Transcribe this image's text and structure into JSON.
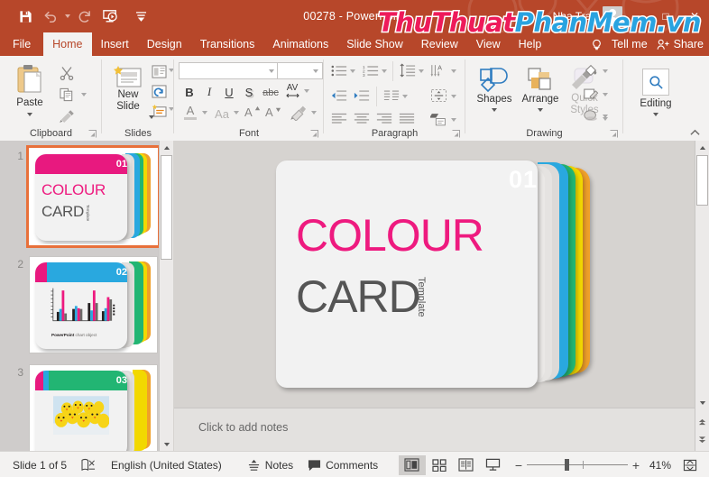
{
  "titlebar": {
    "document_title": "00278  -  PowerPoint",
    "account_name": "Nha Tran",
    "qat": [
      {
        "name": "save",
        "label": "Save"
      },
      {
        "name": "undo",
        "label": "Undo"
      },
      {
        "name": "redo",
        "label": "Redo"
      },
      {
        "name": "start-presentation",
        "label": "Start From Beginning"
      },
      {
        "name": "customize-qat",
        "label": "Customize Quick Access Toolbar"
      }
    ],
    "window_buttons": [
      "–",
      "□",
      "✕"
    ],
    "restore_ribbon_icon": "❐"
  },
  "watermark": {
    "part1": "ThuThuat",
    "part2": "PhanMem",
    "part3": ".vn",
    "color1": "#ee1a5a",
    "color2": "#29a3e0"
  },
  "tabs": [
    {
      "label": "File",
      "active": false
    },
    {
      "label": "Home",
      "active": true
    },
    {
      "label": "Insert",
      "active": false
    },
    {
      "label": "Design",
      "active": false
    },
    {
      "label": "Transitions",
      "active": false
    },
    {
      "label": "Animations",
      "active": false
    },
    {
      "label": "Slide Show",
      "active": false
    },
    {
      "label": "Review",
      "active": false
    },
    {
      "label": "View",
      "active": false
    },
    {
      "label": "Help",
      "active": false
    }
  ],
  "tabbar_right": {
    "tell_me": "Tell me",
    "share": "Share"
  },
  "ribbon": {
    "groups": [
      {
        "name": "clipboard",
        "label": "Clipboard"
      },
      {
        "name": "slides",
        "label": "Slides"
      },
      {
        "name": "font",
        "label": "Font"
      },
      {
        "name": "paragraph",
        "label": "Paragraph"
      },
      {
        "name": "drawing",
        "label": "Drawing"
      },
      {
        "name": "editing",
        "label": "Editing"
      }
    ],
    "clipboard": {
      "paste_label": "Paste",
      "cut_label": "Cut",
      "copy_label": "Copy",
      "format_painter_label": "Format Painter"
    },
    "slides": {
      "new_slide_label": "New Slide",
      "layout_label": "Layout",
      "reset_label": "Reset",
      "section_label": "Section"
    },
    "font": {
      "font_name_value": "",
      "font_name_placeholder": "",
      "font_size_value": "",
      "font_size_placeholder": "",
      "bold": "B",
      "italic": "I",
      "underline": "U",
      "shadow": "S",
      "strikethrough": "abc",
      "spacing": "AV",
      "font_color": "A",
      "change_case": "Aa",
      "increase_size": "A",
      "decrease_size": "A",
      "clear_formatting_label": "Clear All Formatting"
    },
    "drawing": {
      "shapes_label": "Shapes",
      "arrange_label": "Arrange",
      "quick_styles_label": "Quick Styles",
      "shape_fill_label": "Shape Fill",
      "shape_outline_label": "Shape Outline",
      "shape_effects_label": "Shape Effects"
    },
    "editing": {
      "editing_label": "Editing"
    }
  },
  "slide_panel": {
    "slides": [
      {
        "number": "1",
        "selected": true,
        "badge": "01",
        "header_color": "#e8197f",
        "title_line1": "COLOUR",
        "title_line2": "CARD",
        "vertical_label": "Template"
      },
      {
        "number": "2",
        "selected": false,
        "badge": "02",
        "header_color": "#29a8df",
        "caption_bold": "PowerPoint",
        "caption_rest": " chart object"
      },
      {
        "number": "3",
        "selected": false,
        "badge": "03",
        "header_color": "#22b573"
      }
    ]
  },
  "main_slide": {
    "badge": "01",
    "header_color": "#e8197f",
    "title_line1": "COLOUR",
    "title_line1_color": "#ee1a7f",
    "title_line2": "CARD",
    "title_line2_color": "#555555",
    "vertical_label": "Template",
    "stack_colors": [
      "#29a8df",
      "#22b573",
      "#f2d800",
      "#f0a02a"
    ]
  },
  "notes": {
    "placeholder": "Click to add notes"
  },
  "status": {
    "slide_counter": "Slide 1 of 5",
    "accessibility_icon": "accessibility-checker-icon",
    "language": "English (United States)",
    "notes_label": "Notes",
    "comments_label": "Comments",
    "views": [
      {
        "name": "normal-view",
        "active": true
      },
      {
        "name": "slide-sorter-view",
        "active": false
      },
      {
        "name": "reading-view",
        "active": false
      },
      {
        "name": "slide-show-view",
        "active": false
      }
    ],
    "zoom_out": "−",
    "zoom_in": "+",
    "zoom_level": "41%",
    "fit_label": "Fit slide to current window"
  }
}
